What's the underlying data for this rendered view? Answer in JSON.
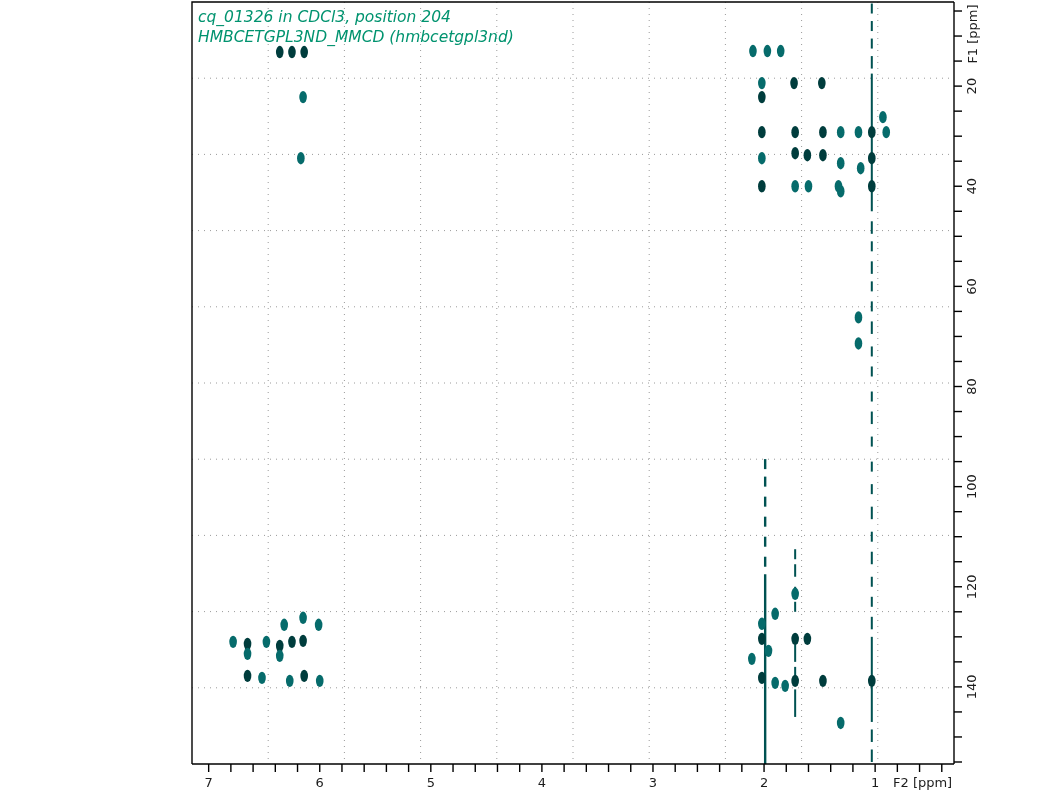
{
  "spectrum": {
    "pulse_program": "HMBCETGPL3ND_MMCD (hmbcetgpl3nd)",
    "chart_data": {
      "type": "scatter",
      "title": "cq_01326 in CDCl3, position 204",
      "xlabel": "F2 [ppm]",
      "ylabel": "F1 [ppm]",
      "xlim": [
        7.15,
        0.29
      ],
      "ylim": [
        155.4,
        3.2
      ],
      "xticks": [
        7,
        6,
        5,
        4,
        3,
        2,
        1
      ],
      "yticks": [
        20,
        40,
        60,
        80,
        100,
        120,
        140
      ],
      "series": [
        {
          "color": "#003d3d",
          "x": [
            6.36,
            6.25,
            6.14,
            2.02,
            1.73,
            1.48,
            2.02,
            1.72,
            1.47,
            1.03,
            1.72,
            1.61,
            1.47,
            1.03,
            2.02,
            1.03,
            1.72,
            1.72,
            1.03,
            2.02,
            2.02,
            6.65,
            6.14,
            6.36,
            6.15,
            6.65,
            1.61,
            1.47,
            6.25
          ],
          "values": [
            13.2,
            13.2,
            13.2,
            22.2,
            19.4,
            19.4,
            29.2,
            29.2,
            29.2,
            29.2,
            33.4,
            33.8,
            33.8,
            34.4,
            40.0,
            40.0,
            138.8,
            130.4,
            138.8,
            130.4,
            138.2,
            137.8,
            137.8,
            131.8,
            130.8,
            131.4,
            130.4,
            138.8,
            131.0
          ]
        },
        {
          "color": "#066b6b",
          "x": [
            2.1,
            1.97,
            1.85,
            2.02,
            6.15,
            6.17,
            1.31,
            1.15,
            0.9,
            2.02,
            1.31,
            1.13,
            1.72,
            1.6,
            1.33,
            1.31,
            0.93,
            1.15,
            1.15,
            6.15,
            6.32,
            6.01,
            6.78,
            6.48,
            6.65,
            6.36,
            6.52,
            6.27,
            6.0,
            2.02,
            1.96,
            2.11,
            1.9,
            1.9,
            1.72,
            1.81,
            1.31
          ],
          "values": [
            13.0,
            13.0,
            13.0,
            19.4,
            22.2,
            34.4,
            29.2,
            29.2,
            29.2,
            34.4,
            35.4,
            36.4,
            40.0,
            40.0,
            40.0,
            41.0,
            26.2,
            66.2,
            71.4,
            126.2,
            127.6,
            127.6,
            131.0,
            131.0,
            133.4,
            133.8,
            138.2,
            138.8,
            138.8,
            127.4,
            132.8,
            134.4,
            139.2,
            125.4,
            121.4,
            139.8,
            147.2
          ]
        }
      ]
    }
  }
}
